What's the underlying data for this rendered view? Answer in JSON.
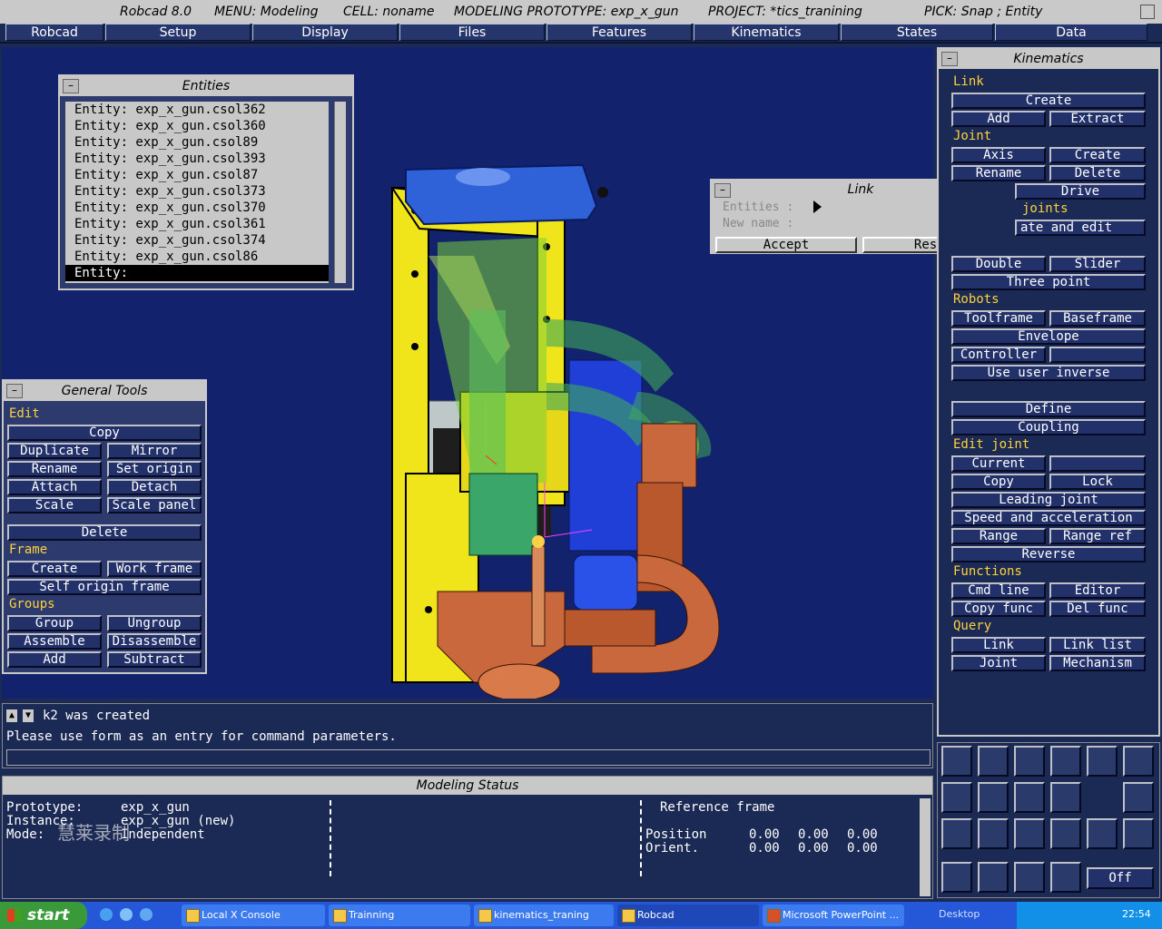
{
  "title_bar": {
    "app": "Robcad 8.0",
    "menu": "MENU: Modeling",
    "cell": "CELL: noname",
    "prototype": "MODELING PROTOTYPE: exp_x_gun",
    "project": "PROJECT: *tics_tranining",
    "pick": "PICK: Snap ; Entity"
  },
  "menu_bar": [
    "Robcad",
    "Setup",
    "Display",
    "Files",
    "Features",
    "Kinematics",
    "States",
    "Data"
  ],
  "entities_panel": {
    "title": "Entities",
    "items": [
      "Entity: exp_x_gun.csol362",
      "Entity: exp_x_gun.csol360",
      "Entity: exp_x_gun.csol89",
      "Entity: exp_x_gun.csol393",
      "Entity: exp_x_gun.csol87",
      "Entity: exp_x_gun.csol373",
      "Entity: exp_x_gun.csol370",
      "Entity: exp_x_gun.csol361",
      "Entity: exp_x_gun.csol374",
      "Entity: exp_x_gun.csol86",
      "Entity:"
    ]
  },
  "link_dialog": {
    "title": "Link",
    "entities_label": "Entities :",
    "new_name_label": "New name :",
    "accept": "Accept",
    "reset": "Reset"
  },
  "general_tools": {
    "title": "General Tools",
    "edit_header": "Edit",
    "copy": "Copy",
    "duplicate": "Duplicate",
    "mirror": "Mirror",
    "rename": "Rename",
    "set_origin": "Set origin",
    "attach": "Attach",
    "detach": "Detach",
    "scale": "Scale",
    "scale_panel": "Scale panel",
    "delete": "Delete",
    "frame_header": "Frame",
    "create": "Create",
    "work_frame": "Work frame",
    "self_origin_frame": "Self origin frame",
    "groups_header": "Groups",
    "group": "Group",
    "ungroup": "Ungroup",
    "assemble": "Assemble",
    "disassemble": "Disassemble",
    "add": "Add",
    "subtract": "Subtract"
  },
  "kinematics_panel": {
    "title": "Kinematics",
    "link_header": "Link",
    "link_create": "Create",
    "link_add": "Add",
    "link_extract": "Extract",
    "joint_header": "Joint",
    "axis": "Axis",
    "joint_create": "Create",
    "rename": "Rename",
    "joint_delete": "Delete",
    "drive": "Drive",
    "joints_header": "joints",
    "create_and_edit": "ate and edit",
    "double": "Double",
    "slider": "Slider",
    "three_point": "Three point",
    "robots_header": "Robots",
    "toolframe": "Toolframe",
    "baseframe": "Baseframe",
    "envelope": "Envelope",
    "controller": "Controller",
    "use_user_inverse": "Use user inverse",
    "define": "Define",
    "coupling": "Coupling",
    "edit_joint_header": "Edit joint",
    "current": "Current",
    "copy": "Copy",
    "lock": "Lock",
    "leading_joint": "Leading joint",
    "speed_accel": "Speed and acceleration",
    "range": "Range",
    "range_ref": "Range ref",
    "reverse": "Reverse",
    "functions_header": "Functions",
    "cmd_line": "Cmd line",
    "editor": "Editor",
    "copy_func": "Copy func",
    "del_func": "Del func",
    "query_header": "Query",
    "q_link": "Link",
    "link_list": "Link list",
    "q_joint": "Joint",
    "mechanism": "Mechanism"
  },
  "command_area": {
    "message1": "k2 was created",
    "message2": "Please use form as an entry for command parameters."
  },
  "modeling_status": {
    "title": "Modeling Status",
    "prototype_label": "Prototype:",
    "prototype_value": "exp_x_gun",
    "instance_label": "Instance:",
    "instance_value": "exp_x_gun (new)",
    "mode_label": "Mode:",
    "mode_value": "Independent",
    "watermark": "慧莱录制",
    "reference_frame": "Reference frame",
    "position_label": "Position",
    "orient_label": "Orient.",
    "position": [
      "0.00",
      "0.00",
      "0.00"
    ],
    "orient": [
      "0.00",
      "0.00",
      "0.00"
    ]
  },
  "toolbar": {
    "off_label": "Off"
  },
  "taskbar": {
    "start": "start",
    "tasks": [
      "Local X Console",
      "Trainning",
      "kinematics_traning",
      "Robcad",
      "Microsoft PowerPoint ..."
    ],
    "desktop": "Desktop",
    "clock": "22:54"
  }
}
